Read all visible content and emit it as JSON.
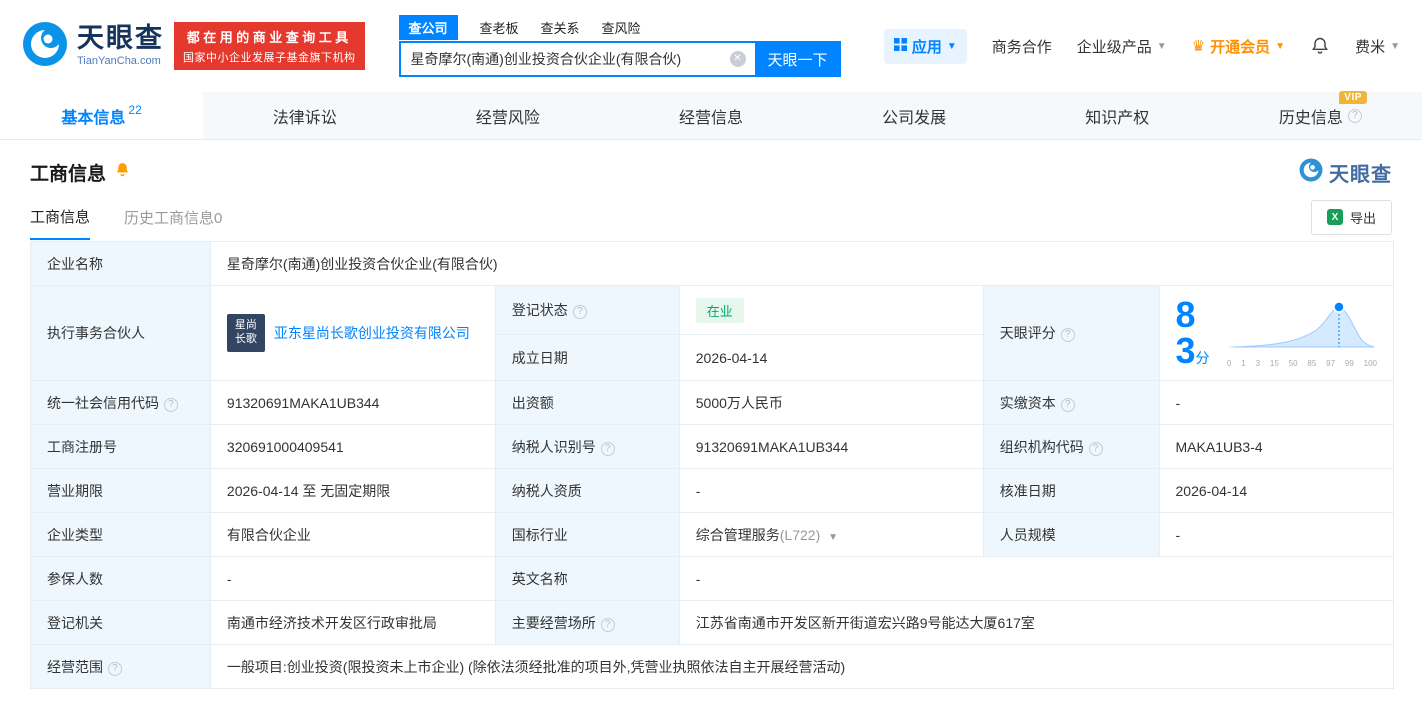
{
  "colors": {
    "accent": "#0084ff",
    "brand_red": "#e6392e",
    "label_bg": "#eef7fe",
    "border": "#e7edf3",
    "status_green": "#00a870",
    "status_green_bg": "#e6f7ee",
    "vip_gold": "#efb537",
    "member_orange": "#ff9000",
    "link": "#0084ff"
  },
  "header": {
    "logo": {
      "brand": "天眼查",
      "domain": "TianYanCha.com"
    },
    "badge": {
      "line1": "都在用的商业查询工具",
      "line2": "国家中小企业发展子基金旗下机构"
    },
    "search_tabs": [
      {
        "label": "查公司"
      },
      {
        "label": "查老板"
      },
      {
        "label": "查关系"
      },
      {
        "label": "查风险"
      }
    ],
    "search": {
      "value": "星奇摩尔(南通)创业投资合伙企业(有限合伙)",
      "button": "天眼一下"
    },
    "menu": {
      "apps": "应用",
      "cooperation": "商务合作",
      "enterprise": "企业级产品",
      "vip": "开通会员",
      "user": "费米"
    }
  },
  "nav_tabs": [
    {
      "label": "基本信息",
      "count": "22"
    },
    {
      "label": "法律诉讼"
    },
    {
      "label": "经营风险"
    },
    {
      "label": "经营信息"
    },
    {
      "label": "公司发展"
    },
    {
      "label": "知识产权"
    },
    {
      "label": "历史信息",
      "badge": "VIP"
    }
  ],
  "section": {
    "title": "工商信息",
    "logo_text": "天眼查"
  },
  "subtabs": {
    "current": "工商信息",
    "history": "历史工商信息",
    "history_count": "0",
    "export": "导出"
  },
  "fields": {
    "company_name": {
      "label": "企业名称",
      "value": "星奇摩尔(南通)创业投资合伙企业(有限合伙)"
    },
    "managing_partner": {
      "label": "执行事务合伙人",
      "logo1": "星尚",
      "logo2": "长歌",
      "value": "亚东星尚长歌创业投资有限公司"
    },
    "reg_status": {
      "label": "登记状态",
      "value": "在业"
    },
    "establish_date": {
      "label": "成立日期",
      "value": "2026-04-14"
    },
    "tyc_score": {
      "label": "天眼评分"
    },
    "credit_code": {
      "label": "统一社会信用代码",
      "value": "91320691MAKA1UB344"
    },
    "capital": {
      "label": "出资额",
      "value": "5000万人民币"
    },
    "paid_capital": {
      "label": "实缴资本",
      "value": "-"
    },
    "reg_number": {
      "label": "工商注册号",
      "value": "320691000409541"
    },
    "taxpayer_id": {
      "label": "纳税人识别号",
      "value": "91320691MAKA1UB344"
    },
    "org_code": {
      "label": "组织机构代码",
      "value": "MAKA1UB3-4"
    },
    "business_term": {
      "label": "营业期限",
      "value": "2026-04-14 至 无固定期限"
    },
    "taxpayer_quality": {
      "label": "纳税人资质",
      "value": "-"
    },
    "approval_date": {
      "label": "核准日期",
      "value": "2026-04-14"
    },
    "company_type": {
      "label": "企业类型",
      "value": "有限合伙企业"
    },
    "industry": {
      "label": "国标行业",
      "value": "综合管理服务",
      "code": "(L722)"
    },
    "staff_size": {
      "label": "人员规模",
      "value": "-"
    },
    "insured_count": {
      "label": "参保人数",
      "value": "-"
    },
    "english_name": {
      "label": "英文名称",
      "value": "-"
    },
    "reg_authority": {
      "label": "登记机关",
      "value": "南通市经济技术开发区行政审批局"
    },
    "business_address": {
      "label": "主要经营场所",
      "value": "江苏省南通市开发区新开街道宏兴路9号能达大厦617室"
    },
    "business_scope": {
      "label": "经营范围",
      "value": "一般项目:创业投资(限投资未上市企业) (除依法须经批准的项目外,凭营业执照依法自主开展经营活动)"
    }
  },
  "score": {
    "value": "83",
    "unit": "分",
    "ticks": [
      "0",
      "1",
      "3",
      "15",
      "50",
      "85",
      "97",
      "99",
      "100"
    ]
  }
}
